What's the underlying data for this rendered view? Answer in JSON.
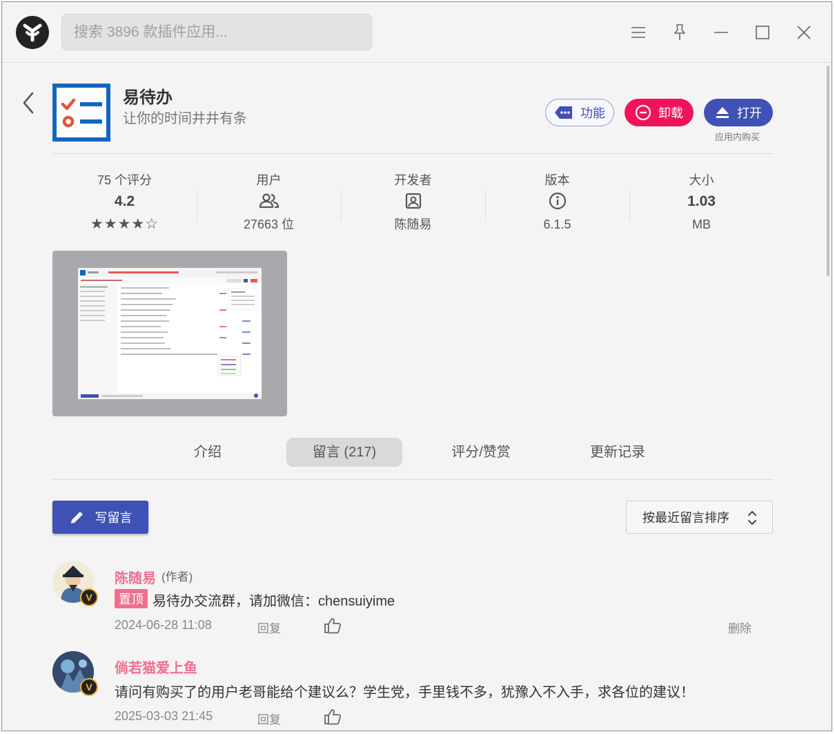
{
  "search": {
    "placeholder": "搜索 3896 款插件应用..."
  },
  "app": {
    "name": "易待办",
    "description": "让你的时间井井有条",
    "buttons": {
      "feature": "功能",
      "uninstall": "卸载",
      "open": "打开"
    },
    "in_app_purchase": "应用内购买"
  },
  "stats": {
    "rating": {
      "label": "75 个评分",
      "value": "4.2",
      "stars": "★★★★☆",
      "score": 4.2
    },
    "users": {
      "label": "用户",
      "value": "27663 位"
    },
    "developer": {
      "label": "开发者",
      "value": "陈随易"
    },
    "version": {
      "label": "版本",
      "value": "6.1.5"
    },
    "size": {
      "label": "大小",
      "value": "1.03",
      "unit": "MB"
    }
  },
  "tabs": [
    {
      "label": "介绍"
    },
    {
      "label": "留言 (217)"
    },
    {
      "label": "评分/赞赏"
    },
    {
      "label": "更新记录"
    }
  ],
  "actions": {
    "write": "写留言",
    "sort": "按最近留言排序"
  },
  "comments": [
    {
      "name": "陈随易",
      "role": "(作者)",
      "pin": "置顶",
      "text": "易待办交流群，请加微信：chensuiyime",
      "time": "2024-06-28 11:08",
      "reply": "回复",
      "delete": "删除"
    },
    {
      "name": "倘若猫爱上鱼",
      "text": "请问有购买了的用户老哥能给个建议么？学生党，手里钱不多，犹豫入不入手，求各位的建议！",
      "time": "2025-03-03 21:45",
      "reply": "回复"
    }
  ],
  "colors": {
    "primary": "#3f51b5",
    "danger": "#f0135a",
    "username": "#ef6f8e",
    "icon_blue": "#1565c0"
  }
}
